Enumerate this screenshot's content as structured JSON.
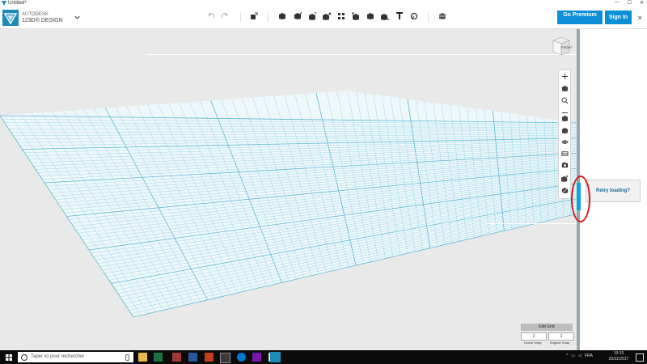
{
  "window": {
    "title": "Untitled*",
    "controls": [
      "—",
      "☐",
      "✕"
    ]
  },
  "brand": {
    "line1": "AUTODESK",
    "line2": "123D® DESIGN",
    "menu_icon": "chevron-down-icon"
  },
  "toolbar": {
    "undo_icon": "undo-icon",
    "redo_icon": "redo-icon",
    "tools": [
      "transform-icon",
      "primitives-icon",
      "sketch-icon",
      "construct-icon",
      "modify-icon",
      "pattern-icon",
      "grouping-icon",
      "combine-icon",
      "measure-icon",
      "text-icon",
      "snap-icon",
      "material-icon"
    ]
  },
  "header": {
    "premium_label": "Go Premium",
    "premium_sub": "",
    "signin_label": "Sign In"
  },
  "viewcube": {
    "label": "FRONT"
  },
  "navbar": {
    "icons": [
      "zoom-plus-icon",
      "pan-icon",
      "zoom-icon",
      "zoom-minus-icon",
      "fit-icon",
      "visibility-icon",
      "materials-outlines-icon",
      "camera-icon",
      "grid-icon",
      "shading-icon"
    ]
  },
  "panel": {
    "retry_label": "Retry loading?"
  },
  "grid_panel": {
    "edit_label": "Edit Grid",
    "linear_value": "1",
    "angular_value": "1",
    "linear_label": "Linear Snap",
    "angular_label": "Angular Snap"
  },
  "taskbar": {
    "search_placeholder": "Taper ici pour rechercher",
    "apps": [
      "file-explorer-icon",
      "excel-icon",
      "access-icon",
      "word-icon",
      "powerpoint-icon",
      "store-icon",
      "edge-icon",
      "onenote-icon",
      "mail-icon",
      "123d-icon"
    ],
    "tray_text": "FRA",
    "clock_time": "19:15",
    "clock_date": "20/11/2017"
  },
  "colors": {
    "accent": "#0b8fd6",
    "grid_line": "#7fcde0",
    "grid_major": "#5bb9d3",
    "annotation": "#cf1b1b"
  }
}
